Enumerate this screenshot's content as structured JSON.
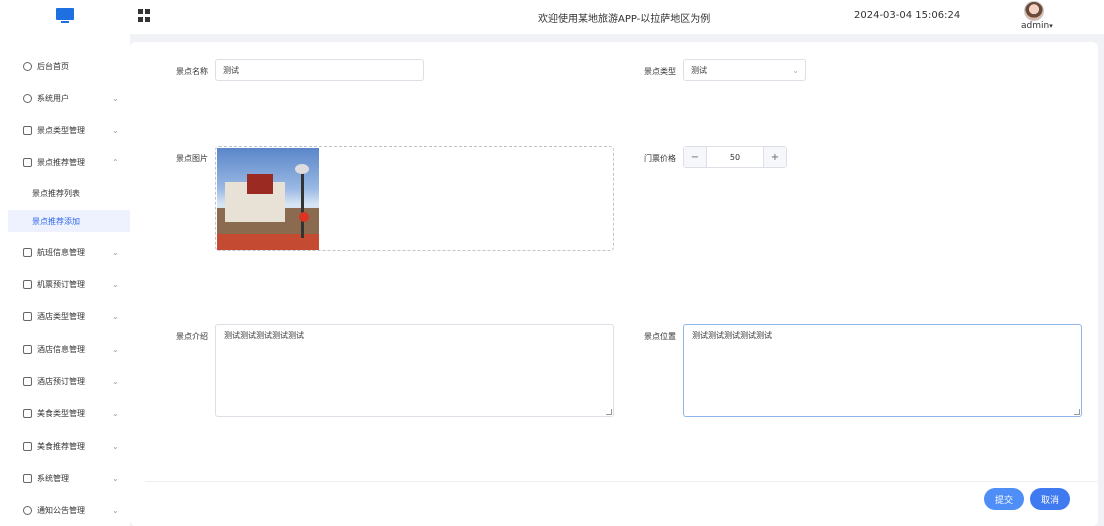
{
  "header": {
    "title": "欢迎使用某地旅游APP-以拉萨地区为例",
    "datetime": "2024-03-04 15:06:24",
    "username": "admin",
    "logo_icon": "monitor-icon",
    "menu_toggle_icon": "grid-icon"
  },
  "sidebar": {
    "items": [
      {
        "label": "后台首页",
        "icon": "clock-icon"
      },
      {
        "label": "系统用户",
        "icon": "user-icon"
      },
      {
        "label": "景点类型管理",
        "icon": "folder-icon"
      },
      {
        "label": "景点推荐管理",
        "icon": "folder-icon"
      },
      {
        "label": "航班信息管理",
        "icon": "folder-icon"
      },
      {
        "label": "机票预订管理",
        "icon": "folder-icon"
      },
      {
        "label": "酒店类型管理",
        "icon": "folder-icon"
      },
      {
        "label": "酒店信息管理",
        "icon": "folder-icon"
      },
      {
        "label": "酒店预订管理",
        "icon": "folder-icon"
      },
      {
        "label": "美食类型管理",
        "icon": "folder-icon"
      },
      {
        "label": "美食推荐管理",
        "icon": "folder-icon"
      },
      {
        "label": "系统管理",
        "icon": "folder-icon"
      },
      {
        "label": "通知公告管理",
        "icon": "settings-icon"
      }
    ],
    "sub_items": [
      {
        "label": "景点推荐列表"
      },
      {
        "label": "景点推荐添加"
      }
    ]
  },
  "form": {
    "name_label": "景点名称",
    "name_value": "测试",
    "type_label": "景点类型",
    "type_value": "测试",
    "image_label": "景点图片",
    "price_label": "门票价格",
    "price_value": "50",
    "price_minus": "−",
    "price_plus": "+",
    "intro_label": "景点介绍",
    "intro_value": "测试测试测试测试测试",
    "location_label": "景点位置",
    "location_value": "测试测试测试测试测试"
  },
  "actions": {
    "submit_label": "提交",
    "cancel_label": "取消"
  },
  "colors": {
    "primary": "#2c66e8",
    "button": "#4f8ef7"
  }
}
